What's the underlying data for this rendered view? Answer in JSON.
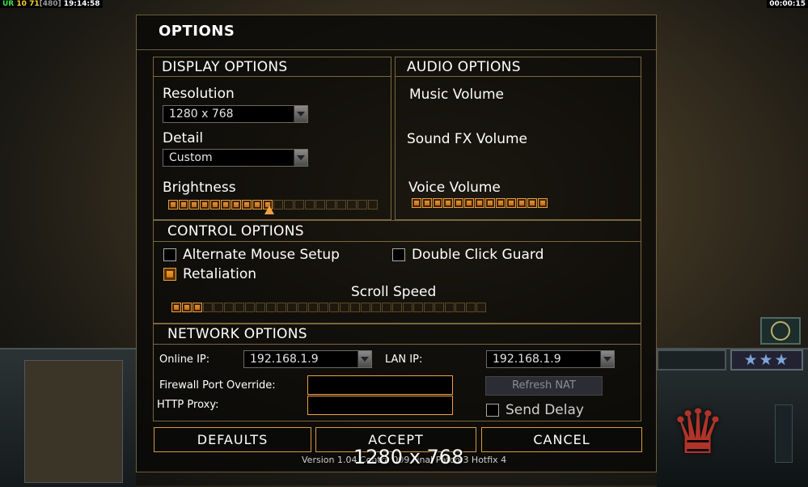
{
  "hud": {
    "prefix": "UR",
    "a": "10",
    "b": "71",
    "bracket": "[480]",
    "clock": "19:14:58",
    "timer": "00:00:15"
  },
  "sidebar": {
    "rank_stars": "★★★"
  },
  "dialog": {
    "title": "OPTIONS",
    "display": {
      "heading": "DISPLAY OPTIONS",
      "resolution_label": "Resolution",
      "resolution_value": "1280 x 768",
      "detail_label": "Detail",
      "detail_value": "Custom",
      "brightness_label": "Brightness",
      "brightness_level": 0.49
    },
    "audio": {
      "heading": "AUDIO OPTIONS",
      "music_label": "Music Volume",
      "sfx_label": "Sound FX Volume",
      "voice_label": "Voice Volume",
      "voice_level": 1.0
    },
    "control": {
      "heading": "CONTROL OPTIONS",
      "alt_mouse_label": "Alternate Mouse Setup",
      "alt_mouse_checked": false,
      "double_click_label": "Double Click Guard",
      "double_click_checked": false,
      "retaliation_label": "Retaliation",
      "retaliation_checked": true,
      "scroll_label": "Scroll Speed",
      "scroll_level": 0.1
    },
    "network": {
      "heading": "NETWORK OPTIONS",
      "online_ip_label": "Online IP:",
      "online_ip_value": "192.168.1.9",
      "lan_ip_label": "LAN IP:",
      "lan_ip_value": "192.168.1.9",
      "firewall_label": "Firewall Port Override:",
      "firewall_value": "",
      "proxy_label": "HTTP Proxy:",
      "proxy_value": "",
      "refresh_nat_label": "Refresh NAT",
      "send_delay_label": "Send Delay",
      "send_delay_checked": false
    },
    "buttons": {
      "defaults": "DEFAULTS",
      "accept": "ACCEPT",
      "cancel": "CANCEL"
    },
    "version": "Version 1.04 Contra 009 Final Patch 3 Hotfix 4",
    "resolution_overlay": "1280 x 768"
  },
  "colors": {
    "accent": "#f0a040",
    "frame": "#7a673e"
  }
}
